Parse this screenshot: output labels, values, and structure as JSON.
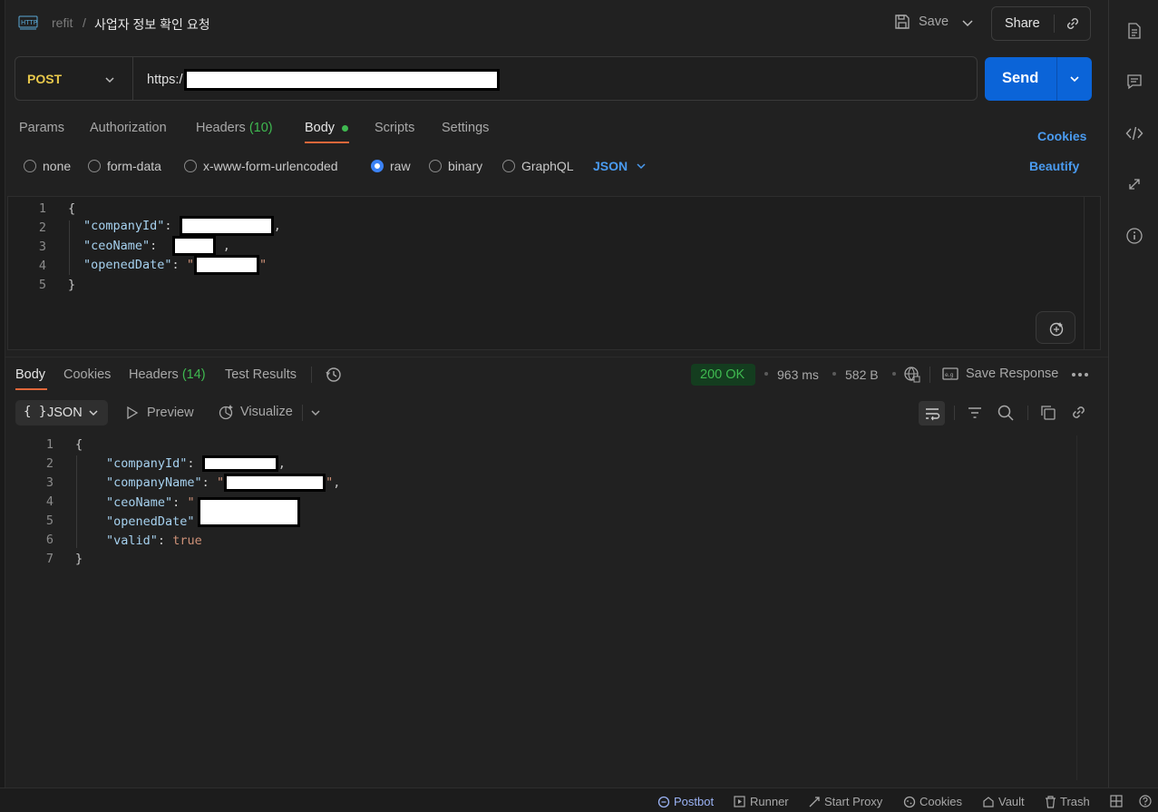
{
  "header": {
    "protocol_icon": "http-icon",
    "collection": "refit",
    "separator": "/",
    "request_name": "사업자 정보 확인 요청",
    "save_label": "Save",
    "share_label": "Share"
  },
  "request": {
    "method": "POST",
    "url_prefix": "https:/",
    "send_label": "Send"
  },
  "request_tabs": [
    {
      "label": "Params"
    },
    {
      "label": "Authorization"
    },
    {
      "label": "Headers",
      "count": "(10)"
    },
    {
      "label": "Body"
    },
    {
      "label": "Scripts"
    },
    {
      "label": "Settings"
    }
  ],
  "cookies_link": "Cookies",
  "body_types": [
    "none",
    "form-data",
    "x-www-form-urlencoded",
    "raw",
    "binary",
    "GraphQL"
  ],
  "body_format": "JSON",
  "beautify_label": "Beautify",
  "request_body": {
    "line_numbers": [
      "1",
      "2",
      "3",
      "4",
      "5"
    ],
    "open": "{",
    "close": "}",
    "k1": "\"companyId\"",
    "k2": "\"ceoName\"",
    "k3": "\"openedDate\"",
    "colon": ":",
    "comma": ",",
    "quote": "\""
  },
  "response_tabs": [
    {
      "label": "Body"
    },
    {
      "label": "Cookies"
    },
    {
      "label": "Headers",
      "count": "(14)"
    },
    {
      "label": "Test Results"
    }
  ],
  "response_status": {
    "status": "200 OK",
    "time": "963 ms",
    "size": "582 B",
    "save_response": "Save Response",
    "status_color": "#3fb950"
  },
  "response_view": {
    "format": "JSON",
    "format_brace": "{ }",
    "preview": "Preview",
    "visualize": "Visualize"
  },
  "response_body": {
    "line_numbers": [
      "1",
      "2",
      "3",
      "4",
      "5",
      "6",
      "7"
    ],
    "open": "{",
    "close": "}",
    "k1": "\"companyId\"",
    "k2": "\"companyName\"",
    "k3": "\"ceoName\"",
    "k4": "\"openedDate\"",
    "k5": "\"valid\"",
    "v5": "true",
    "colon": ":",
    "comma": ",",
    "quote": "\""
  },
  "footer": {
    "postbot": "Postbot",
    "runner": "Runner",
    "start_proxy": "Start Proxy",
    "cookies": "Cookies",
    "vault": "Vault",
    "trash": "Trash"
  },
  "colors": {
    "accent_blue": "#0b64d8",
    "method_post": "#e8c84b",
    "body_dot": "#3fb950"
  }
}
